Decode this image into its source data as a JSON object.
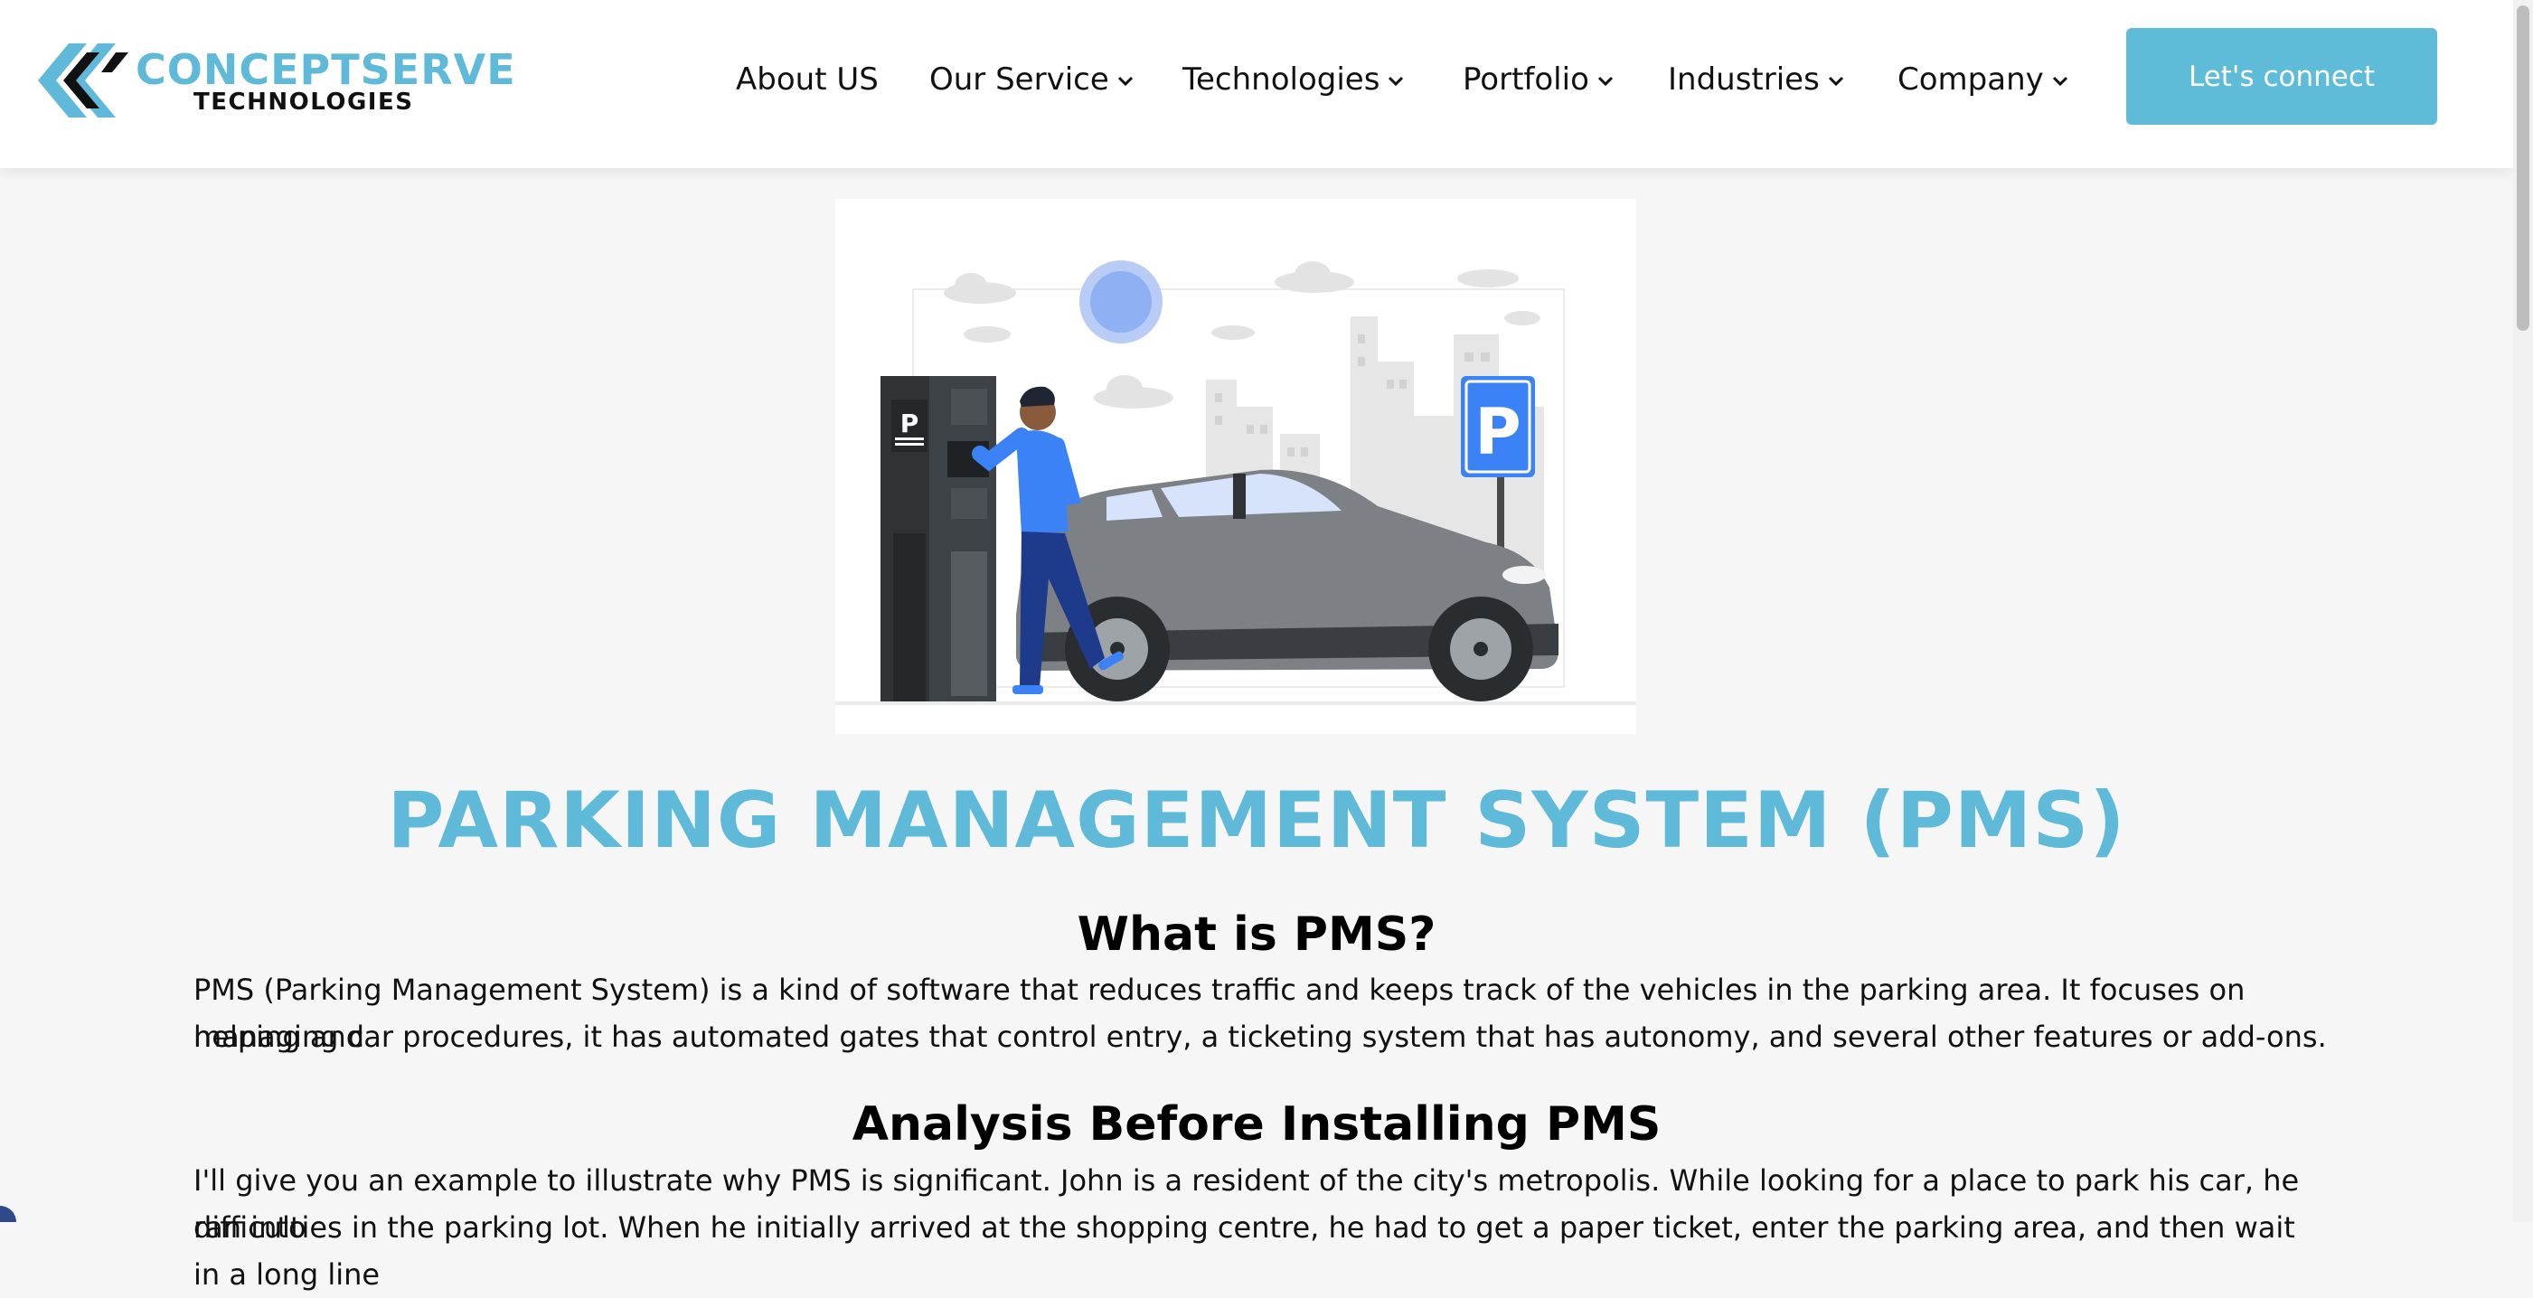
{
  "header": {
    "logo": {
      "word1": "CONCEPTSERVE",
      "word2": "TECHNOLOGIES"
    },
    "nav": [
      {
        "label": "About US",
        "has_dropdown": false
      },
      {
        "label": "Our Service",
        "has_dropdown": true
      },
      {
        "label": "Technologies",
        "has_dropdown": true
      },
      {
        "label": "Portfolio",
        "has_dropdown": true
      },
      {
        "label": "Industries",
        "has_dropdown": true
      },
      {
        "label": "Company",
        "has_dropdown": true
      }
    ],
    "cta_label": "Let's connect"
  },
  "hero": {
    "sign_letter": "P",
    "kiosk_letter": "P"
  },
  "content": {
    "title": "PARKING MANAGEMENT SYSTEM (PMS)",
    "section1": {
      "heading": "What is PMS?",
      "line1": "PMS (Parking Management System) is a kind of software that reduces traffic and keeps track of the vehicles in the parking area. It focuses on helping and",
      "line2": "managing car procedures, it has automated gates that control entry, a ticketing system that has autonomy, and several other features or add-ons."
    },
    "section2": {
      "heading": "Analysis Before Installing PMS",
      "line1": "I'll give you an example to illustrate why PMS is significant. John is a resident of the city's metropolis. While looking for a place to park his car, he ran into",
      "line2": "difficulties in the parking lot. When he initially arrived at the shopping centre, he had to get a paper ticket, enter the parking area, and then wait in a long line"
    }
  },
  "colors": {
    "accent": "#5fb9d8",
    "button": "#5fbcd9",
    "background": "#f6f6f7",
    "sign": "#3b82f6"
  }
}
